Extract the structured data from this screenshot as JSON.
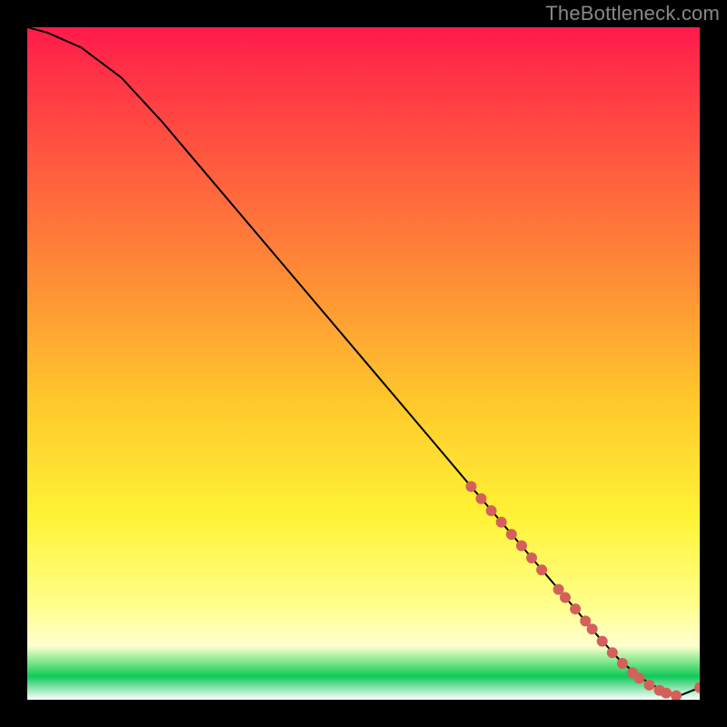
{
  "watermark": "TheBottleneck.com",
  "chart_data": {
    "type": "line",
    "title": "",
    "xlabel": "",
    "ylabel": "",
    "xlim": [
      0,
      100
    ],
    "ylim": [
      0,
      100
    ],
    "series": [
      {
        "name": "curve",
        "x": [
          0,
          3,
          8,
          14,
          20,
          30,
          40,
          50,
          60,
          66,
          70,
          74,
          78,
          82,
          85,
          88,
          91,
          94,
          97,
          100
        ],
        "y": [
          100,
          99.2,
          97,
          92.5,
          86,
          74.2,
          62.4,
          50.6,
          38.8,
          31.7,
          27,
          22.3,
          17.6,
          12.9,
          9.3,
          6.0,
          3.4,
          1.6,
          0.6,
          1.8
        ]
      }
    ],
    "markers": [
      {
        "x": 66,
        "y": 31.7
      },
      {
        "x": 67.5,
        "y": 29.9
      },
      {
        "x": 69,
        "y": 28.1
      },
      {
        "x": 70.5,
        "y": 26.4
      },
      {
        "x": 72,
        "y": 24.6
      },
      {
        "x": 73.5,
        "y": 22.9
      },
      {
        "x": 75,
        "y": 21.1
      },
      {
        "x": 76.5,
        "y": 19.3
      },
      {
        "x": 79,
        "y": 16.4
      },
      {
        "x": 80,
        "y": 15.2
      },
      {
        "x": 81.5,
        "y": 13.5
      },
      {
        "x": 83,
        "y": 11.7
      },
      {
        "x": 84,
        "y": 10.5
      },
      {
        "x": 85.5,
        "y": 8.7
      },
      {
        "x": 87,
        "y": 7.0
      },
      {
        "x": 88.5,
        "y": 5.4
      },
      {
        "x": 90,
        "y": 4.0
      },
      {
        "x": 91,
        "y": 3.2
      },
      {
        "x": 92.5,
        "y": 2.2
      },
      {
        "x": 94,
        "y": 1.4
      },
      {
        "x": 95,
        "y": 1.0
      },
      {
        "x": 96.5,
        "y": 0.6
      },
      {
        "x": 100,
        "y": 1.8
      }
    ],
    "marker_color": "#d4605b",
    "line_color": "#000000"
  }
}
